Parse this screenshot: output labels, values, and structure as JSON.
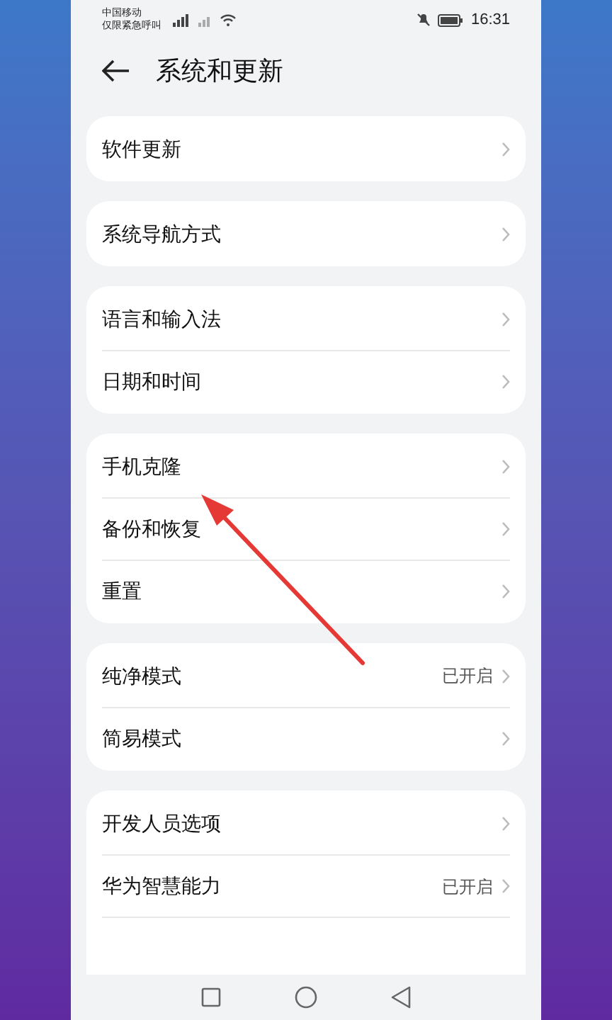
{
  "status_bar": {
    "carrier": "中国移动",
    "carrier_note": "仅限紧急呼叫",
    "time": "16:31"
  },
  "header": {
    "title": "系统和更新"
  },
  "groups": [
    {
      "items": [
        {
          "label": "软件更新"
        }
      ]
    },
    {
      "items": [
        {
          "label": "系统导航方式"
        }
      ]
    },
    {
      "items": [
        {
          "label": "语言和输入法"
        },
        {
          "label": "日期和时间"
        }
      ]
    },
    {
      "items": [
        {
          "label": "手机克隆"
        },
        {
          "label": "备份和恢复"
        },
        {
          "label": "重置"
        }
      ]
    },
    {
      "items": [
        {
          "label": "纯净模式",
          "value": "已开启"
        },
        {
          "label": "简易模式"
        }
      ]
    },
    {
      "items": [
        {
          "label": "开发人员选项"
        },
        {
          "label": "华为智慧能力",
          "value": "已开启"
        }
      ],
      "continues": true
    }
  ]
}
